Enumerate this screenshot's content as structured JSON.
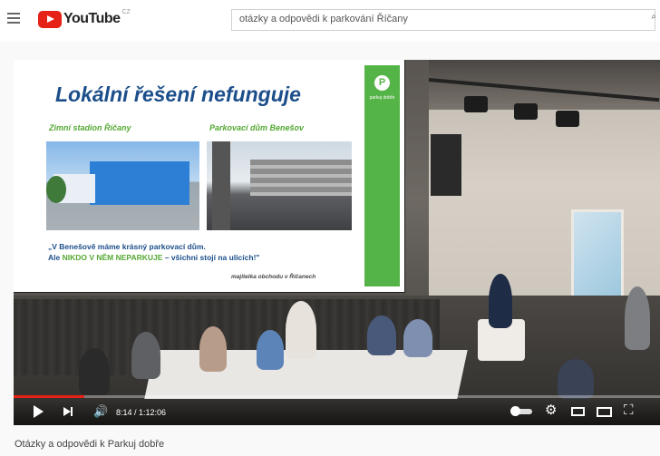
{
  "header": {
    "logo_text": "YouTube",
    "logo_suffix": "CZ",
    "search_value": "otázky a odpovědi k parkování Říčany"
  },
  "slide": {
    "title": "Lokální řešení nefunguje",
    "left_caption": "Zimní stadion Říčany",
    "right_caption": "Parkovací dům Benešov",
    "quote_line1": "„V Benešově máme krásný parkovací dům.",
    "quote_line2_start": "Ale ",
    "quote_line2_highlight": "NIKDO V NĚM NEPARKUJE",
    "quote_line2_end": " – všichni stojí na ulicích!\"",
    "attribution": "majitelka obchodu v Říčanech",
    "badge_letter": "P",
    "badge_text": "parkuj dobře"
  },
  "player": {
    "time": "8:14 / 1:12:06",
    "progress": 0.11
  },
  "video_title": "Otázky a odpovědi k Parkuj dobře",
  "colors": {
    "brand_red": "#e62117",
    "slide_blue": "#1b4e8a",
    "slide_green": "#55b447"
  }
}
